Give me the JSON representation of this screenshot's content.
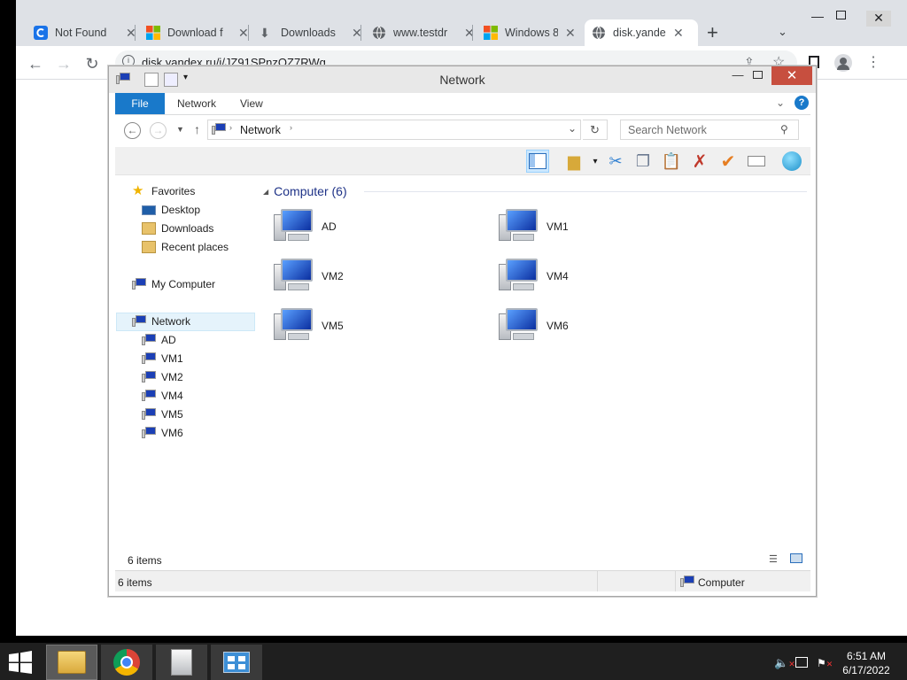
{
  "browser": {
    "tabs": [
      {
        "title": "Not Found",
        "icon": "not-found-icon"
      },
      {
        "title": "Download f",
        "icon": "windows-logo-icon"
      },
      {
        "title": "Downloads",
        "icon": "download-icon"
      },
      {
        "title": "www.testdr",
        "icon": "globe-icon"
      },
      {
        "title": "Windows 8",
        "icon": "windows-logo-icon"
      },
      {
        "title": "disk.yande",
        "icon": "globe-icon"
      }
    ],
    "active_tab": 5,
    "new_tab": "+",
    "url": "disk.yandex.ru/i/JZ91SPnzOZ7RWg"
  },
  "explorer": {
    "title": "Network",
    "ribbon_tabs": [
      "File",
      "Network",
      "View"
    ],
    "path": [
      "Network"
    ],
    "search_placeholder": "Search Network",
    "favorites": {
      "label": "Favorites",
      "items": [
        "Desktop",
        "Downloads",
        "Recent places"
      ]
    },
    "my_computer": "My Computer",
    "network": {
      "label": "Network",
      "items": [
        "AD",
        "VM1",
        "VM2",
        "VM4",
        "VM5",
        "VM6"
      ]
    },
    "group_header": "Computer (6)",
    "computers": [
      "AD",
      "VM1",
      "VM2",
      "VM4",
      "VM5",
      "VM6"
    ],
    "item_count": "6 items",
    "status_left": "6 items",
    "status_right": "Computer"
  },
  "taskbar": {
    "time": "6:51 AM",
    "date": "6/17/2022"
  },
  "colors": {
    "file_tab": "#1979ca",
    "close_button": "#c74f3f",
    "selection": "#e5f3fb",
    "group_header": "#1e3287"
  }
}
